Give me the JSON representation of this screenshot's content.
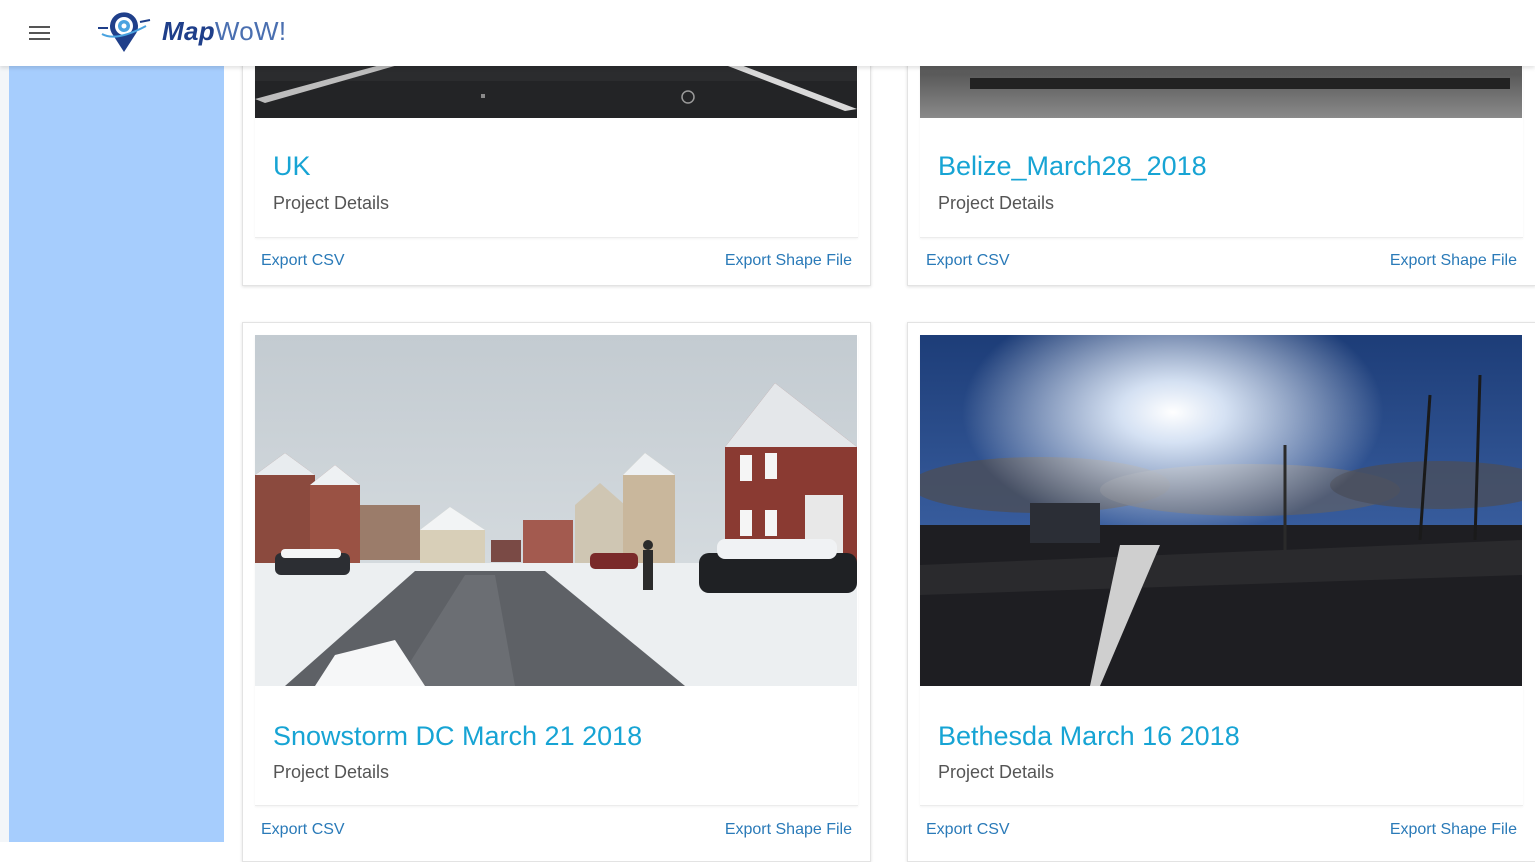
{
  "app": {
    "brand_bold": "Map",
    "brand_light": "WoW!"
  },
  "icons": {
    "menu": "hamburger-menu-icon",
    "logo": "map-pin-logo-icon"
  },
  "colors": {
    "sidebar": "#a6cdfd",
    "title": "#17a4d4",
    "link": "#2a7ab8",
    "brand": "#1f3f8a"
  },
  "projects": [
    {
      "title": "UK",
      "subtitle": "Project Details",
      "export_csv": "Export CSV",
      "export_shape": "Export Shape File"
    },
    {
      "title": "Belize_March28_2018",
      "subtitle": "Project Details",
      "export_csv": "Export CSV",
      "export_shape": "Export Shape File"
    },
    {
      "title": "Snowstorm DC March 21 2018",
      "subtitle": "Project Details",
      "export_csv": "Export CSV",
      "export_shape": "Export Shape File"
    },
    {
      "title": "Bethesda March 16 2018",
      "subtitle": "Project Details",
      "export_csv": "Export CSV",
      "export_shape": "Export Shape File"
    }
  ]
}
